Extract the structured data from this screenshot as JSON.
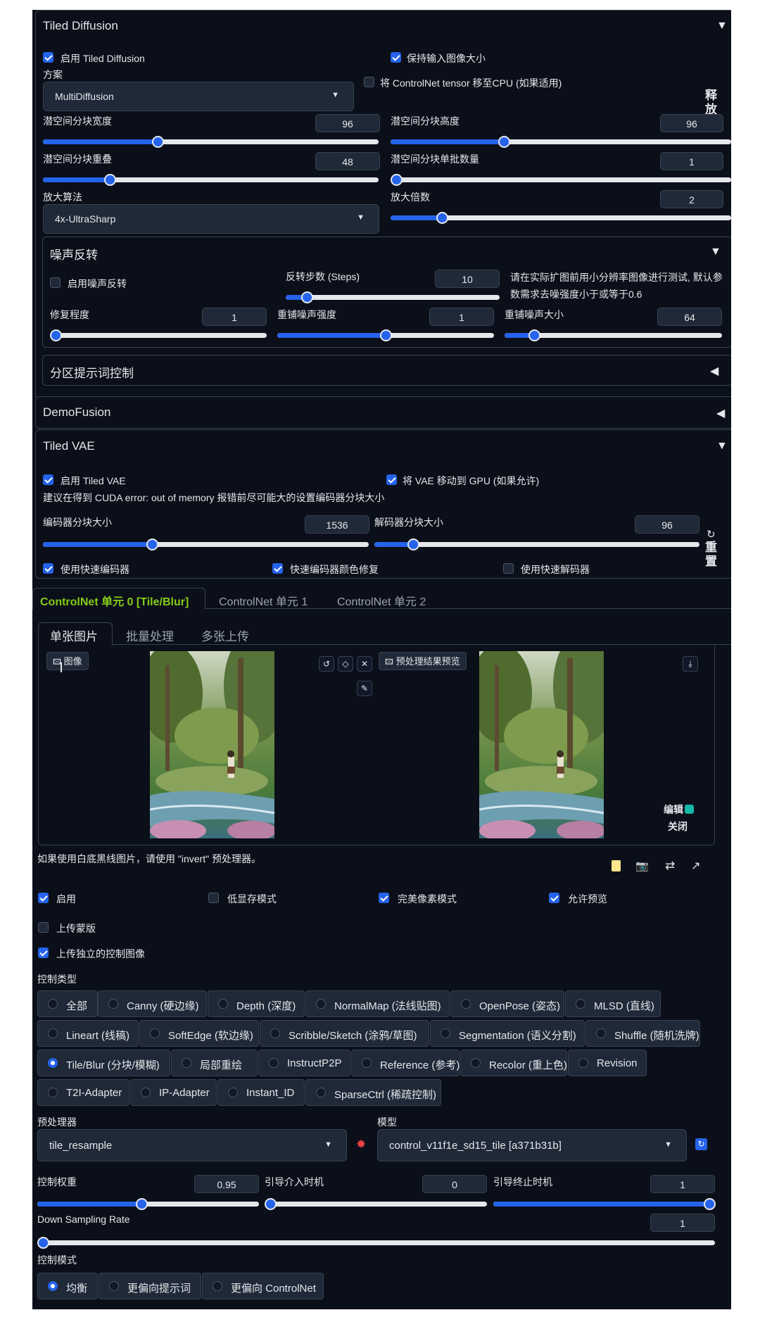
{
  "tiled_diffusion": {
    "title": "Tiled Diffusion",
    "enable_label": "启用 Tiled Diffusion",
    "keep_size_label": "保持输入图像大小",
    "scheme_label": "方案",
    "scheme_value": "MultiDiffusion",
    "controlnet_cpu_label": "将 ControlNet tensor 移至CPU (如果适用)",
    "side_label": "释放",
    "latent_width_label": "潜空间分块宽度",
    "latent_width_value": "96",
    "latent_height_label": "潜空间分块高度",
    "latent_height_value": "96",
    "latent_overlap_label": "潜空间分块重叠",
    "latent_overlap_value": "48",
    "latent_batch_label": "潜空间分块单批数量",
    "latent_batch_value": "1",
    "upscaler_label": "放大算法",
    "upscaler_value": "4x-UltraSharp",
    "scale_label": "放大倍数",
    "scale_value": "2",
    "noise_inversion": {
      "title": "噪声反转",
      "enable_label": "启用噪声反转",
      "steps_label": "反转步数 (Steps)",
      "steps_value": "10",
      "hint": "请在实际扩图前用小分辨率图像进行测试, 默认参数需求去噪强度小于或等于0.6",
      "repair_label": "修复程度",
      "repair_value": "1",
      "renoise_strength_label": "重铺噪声强度",
      "renoise_strength_value": "1",
      "renoise_size_label": "重铺噪声大小",
      "renoise_size_value": "64"
    },
    "region_prompt_title": "分区提示词控制"
  },
  "demofusion": {
    "title": "DemoFusion"
  },
  "tiled_vae": {
    "title": "Tiled VAE",
    "enable_label": "启用 Tiled VAE",
    "move_gpu_label": "将 VAE 移动到 GPU (如果允许)",
    "hint": "建议在得到 CUDA error: out of memory 报错前尽可能大的设置编码器分块大小",
    "encoder_label": "编码器分块大小",
    "encoder_value": "1536",
    "decoder_label": "解码器分块大小",
    "decoder_value": "96",
    "reset_label": "重置",
    "fast_encoder_label": "使用快速编码器",
    "fast_encoder_color_label": "快速编码器颜色修复",
    "fast_decoder_label": "使用快速解码器"
  },
  "controlnet": {
    "unit_tabs": [
      "ControlNet 单元 0 [Tile/Blur]",
      "ControlNet 单元 1",
      "ControlNet 单元 2"
    ],
    "image_tabs": [
      "单张图片",
      "批量处理",
      "多张上传"
    ],
    "image_tag": "图像",
    "preview_tag": "预处理结果预览",
    "edit_label": "编辑",
    "close_label": "关闭",
    "invert_hint": "如果使用白底黑线图片，请使用 \"invert\" 预处理器。",
    "enable_label": "启用",
    "low_vram_label": "低显存模式",
    "pixel_perfect_label": "完美像素模式",
    "allow_preview_label": "允许预览",
    "upload_mask_label": "上传蒙版",
    "upload_independent_label": "上传独立的控制图像",
    "control_type_label": "控制类型",
    "control_types": [
      [
        "全部",
        "Canny (硬边缘)",
        "Depth (深度)",
        "NormalMap (法线贴图)",
        "OpenPose (姿态)",
        "MLSD (直线)"
      ],
      [
        "Lineart (线稿)",
        "SoftEdge (软边缘)",
        "Scribble/Sketch (涂鸦/草图)",
        "Segmentation (语义分割)",
        "Shuffle (随机洗牌)"
      ],
      [
        "Tile/Blur (分块/模糊)",
        "局部重绘",
        "InstructP2P",
        "Reference (参考)",
        "Recolor (重上色)",
        "Revision"
      ],
      [
        "T2I-Adapter",
        "IP-Adapter",
        "Instant_ID",
        "SparseCtrl (稀疏控制)"
      ]
    ],
    "selected_control_type": "Tile/Blur (分块/模糊)",
    "preprocessor_label": "预处理器",
    "preprocessor_value": "tile_resample",
    "model_label": "模型",
    "model_value": "control_v11f1e_sd15_tile [a371b31b]",
    "weight_label": "控制权重",
    "weight_value": "0.95",
    "start_label": "引导介入时机",
    "start_value": "0",
    "end_label": "引导终止时机",
    "end_value": "1",
    "downsampling_label": "Down Sampling Rate",
    "downsampling_value": "1",
    "control_mode_label": "控制模式",
    "control_modes": [
      "均衡",
      "更偏向提示词",
      "更偏向 ControlNet"
    ],
    "selected_control_mode": "均衡"
  }
}
